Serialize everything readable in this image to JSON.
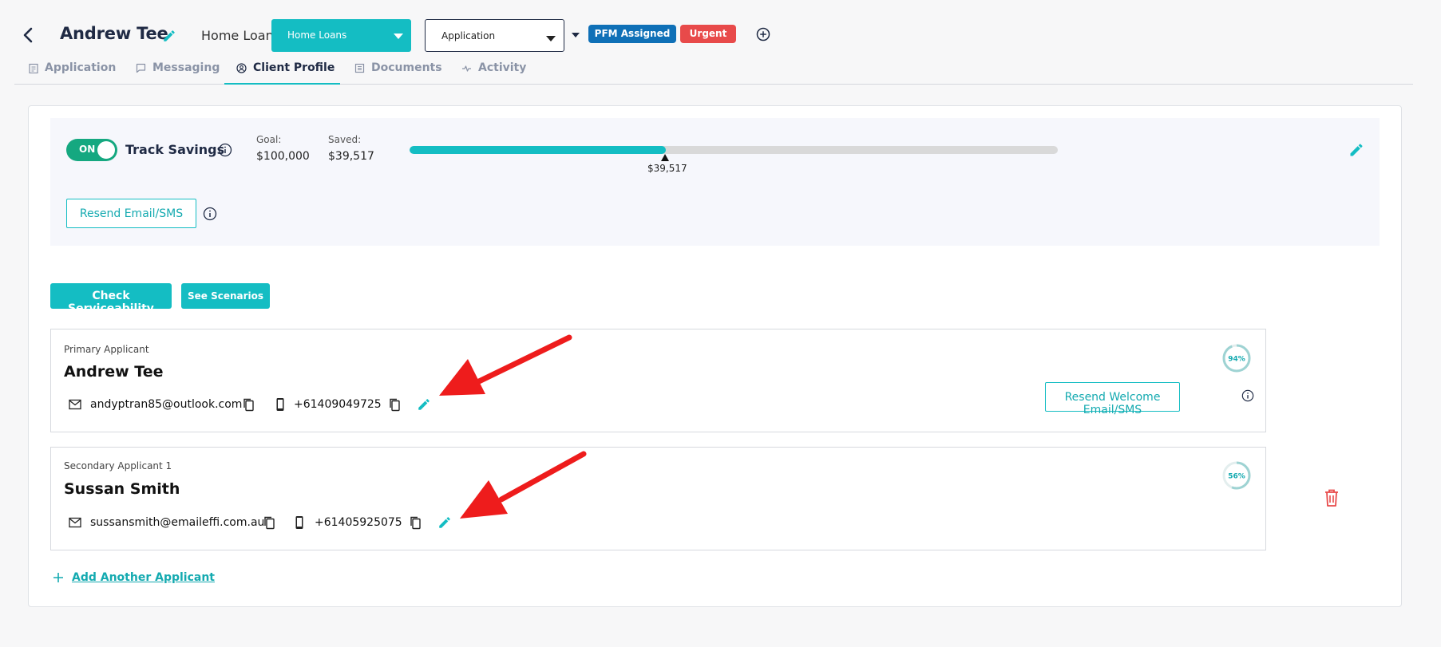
{
  "header": {
    "client_name": "Andrew Tee",
    "loan_type_label": "Home Loan",
    "loan_select": "Home Loans",
    "stage_select": "Application",
    "badges": [
      "PFM Assigned",
      "Urgent"
    ]
  },
  "tabs": [
    {
      "label": "Application",
      "icon": "clipboard-icon"
    },
    {
      "label": "Messaging",
      "icon": "chat-icon"
    },
    {
      "label": "Client Profile",
      "icon": "user-circle-icon",
      "active": true
    },
    {
      "label": "Documents",
      "icon": "documents-icon"
    },
    {
      "label": "Activity",
      "icon": "activity-icon"
    }
  ],
  "savings": {
    "toggle_label": "ON",
    "track_label": "Track Savings",
    "goal_label": "Goal:",
    "goal_value": "$100,000",
    "saved_label": "Saved:",
    "saved_value": "$39,517",
    "progress_fraction": 0.395,
    "progress_label": "$39,517",
    "resend_label": "Resend Email/SMS"
  },
  "actions": {
    "check_serviceability": "Check Serviceability",
    "see_scenarios": "See Scenarios"
  },
  "applicants": [
    {
      "role": "Primary Applicant",
      "name": "Andrew Tee",
      "email": "andyptran85@outlook.com",
      "phone": "+61409049725",
      "completion": "94%",
      "completion_fraction": 0.94,
      "resend_welcome": "Resend Welcome Email/SMS"
    },
    {
      "role": "Secondary Applicant 1",
      "name": "Sussan Smith",
      "email": "sussansmith@emaileffi.com.au",
      "phone": "+61405925075",
      "completion": "56%",
      "completion_fraction": 0.56
    }
  ],
  "add_applicant_label": "Add Another Applicant",
  "colors": {
    "accent": "#14bdc3",
    "toggle_on": "#15a880",
    "pfm_badge": "#0f70b7",
    "urgent_badge": "#e84a4a",
    "annotation_arrow": "#ee1c1c",
    "delete": "#e84a4a"
  }
}
